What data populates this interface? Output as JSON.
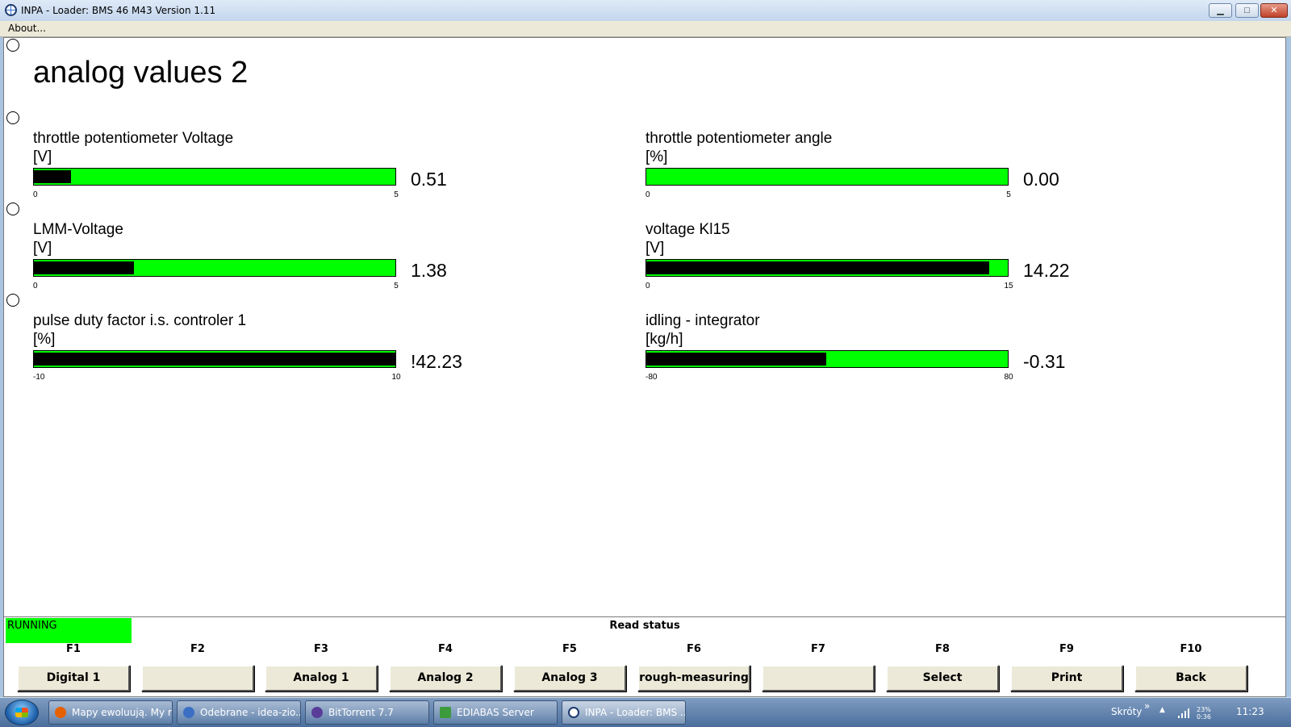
{
  "window": {
    "title": "INPA - Loader:  BMS 46 M43 Version 1.11",
    "min_glyph": "▁",
    "max_glyph": "□",
    "close_glyph": "✕"
  },
  "menu": {
    "about": "About..."
  },
  "page": {
    "title": "analog values 2"
  },
  "gauges": [
    {
      "label": "throttle potentiometer Voltage",
      "unit": "[V]",
      "min": "0",
      "max": "5",
      "value": "0.51",
      "fill": 0.102
    },
    {
      "label": "throttle potentiometer angle",
      "unit": "[%]",
      "min": "0",
      "max": "5",
      "value": "0.00",
      "fill": 0.0
    },
    {
      "label": "LMM-Voltage",
      "unit": "[V]",
      "min": "0",
      "max": "5",
      "value": "1.38",
      "fill": 0.276
    },
    {
      "label": "voltage Kl15",
      "unit": "[V]",
      "min": "0",
      "max": "15",
      "value": "14.22",
      "fill": 0.948
    },
    {
      "label": "pulse duty factor i.s. controler 1",
      "unit": "[%]",
      "min": "-10",
      "max": "10",
      "value": "!42.23",
      "fill": 1.0
    },
    {
      "label": "idling - integrator",
      "unit": "[kg/h]",
      "min": "-80",
      "max": "80",
      "value": "-0.31",
      "fill": 0.498
    }
  ],
  "status": {
    "running": "RUNNING",
    "running_color": "#00ff00",
    "read_status": "Read status"
  },
  "fkeys": [
    {
      "key": "F1",
      "label": "Digital 1"
    },
    {
      "key": "F2",
      "label": ""
    },
    {
      "key": "F3",
      "label": "Analog 1"
    },
    {
      "key": "F4",
      "label": "Analog 2"
    },
    {
      "key": "F5",
      "label": "Analog 3"
    },
    {
      "key": "F6",
      "label": "rough-measuring"
    },
    {
      "key": "F7",
      "label": ""
    },
    {
      "key": "F8",
      "label": "Select"
    },
    {
      "key": "F9",
      "label": "Print"
    },
    {
      "key": "F10",
      "label": "Back"
    }
  ],
  "taskbar": {
    "items": [
      {
        "label": "Mapy ewoluują. My r...",
        "icon": "firefox-icon",
        "color": "#e66000"
      },
      {
        "label": "Odebrane - idea-zio...",
        "icon": "thunderbird-icon",
        "color": "#3a6fc4"
      },
      {
        "label": "BitTorrent 7.7",
        "icon": "bittorrent-icon",
        "color": "#5a3d99"
      },
      {
        "label": "EDIABAS Server",
        "icon": "ediabas-icon",
        "color": "#3d9a3d"
      },
      {
        "label": "INPA - Loader:  BMS ...",
        "icon": "inpa-icon",
        "color": "#1e3a6e"
      }
    ],
    "shortcuts": "Skróty",
    "shortcuts_chevron": "»",
    "tray_arrow": "▲",
    "battery_pct": "23%",
    "battery_time": "0:36",
    "clock": "11:23"
  },
  "colors": {
    "bar_green": "#00ff00",
    "bar_fill": "#000000"
  }
}
